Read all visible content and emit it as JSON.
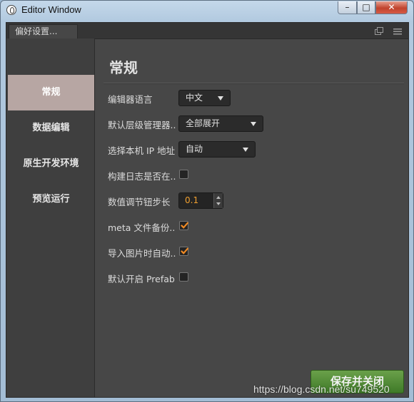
{
  "window": {
    "title": "Editor Window",
    "min_label": "–",
    "max_label": "□",
    "close_label": "✕"
  },
  "tab": {
    "label": "偏好设置..."
  },
  "sidebar": {
    "items": [
      {
        "label": "常规",
        "active": true
      },
      {
        "label": "数据编辑",
        "active": false
      },
      {
        "label": "原生开发环境",
        "active": false
      },
      {
        "label": "预览运行",
        "active": false
      }
    ]
  },
  "main": {
    "title": "常规",
    "rows": [
      {
        "label": "编辑器语言",
        "type": "select",
        "value": "中文"
      },
      {
        "label": "默认层级管理器..",
        "type": "select",
        "value": "全部展开"
      },
      {
        "label": "选择本机 IP 地址",
        "type": "select",
        "value": "自动"
      },
      {
        "label": "构建日志是否在..",
        "type": "checkbox",
        "checked": false
      },
      {
        "label": "数值调节钮步长",
        "type": "number",
        "value": "0.1"
      },
      {
        "label": "meta 文件备份...",
        "type": "checkbox",
        "checked": true
      },
      {
        "label": "导入图片时自动..",
        "type": "checkbox",
        "checked": true
      },
      {
        "label": "默认开启 Prefab..",
        "type": "checkbox",
        "checked": false
      }
    ]
  },
  "footer": {
    "save_label": "保存并关闭"
  },
  "watermark": "https://blog.csdn.net/su749520",
  "icons": {
    "app": "unity-logo-icon",
    "popout": "popout-icon",
    "menu": "hamburger-menu-icon",
    "check": "checkmark-icon",
    "dropdown": "dropdown-arrow-icon"
  },
  "colors": {
    "panel_bg": "#474747",
    "sidebar_bg": "#3f3f3f",
    "active_nav": "#b7a6a3",
    "check_orange": "#f08a24",
    "save_green": "#4f8a33",
    "number_text": "#f0a030"
  }
}
